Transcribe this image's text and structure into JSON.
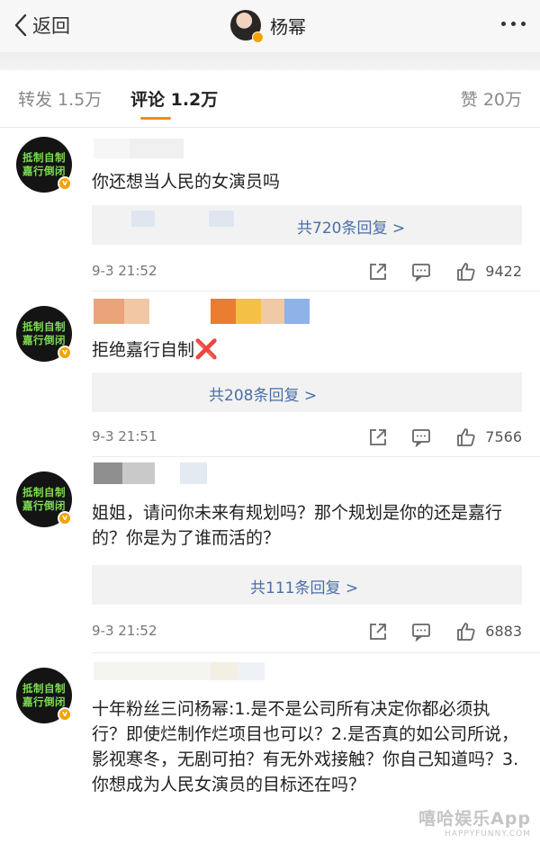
{
  "header": {
    "back_label": "返回",
    "title": "杨幂"
  },
  "tabs": {
    "repost": "转发 1.5万",
    "comments": "评论 1.2万",
    "likes": "赞 20万"
  },
  "avatar_text": [
    "抵制自制",
    "嘉行倒闭"
  ],
  "comments": [
    {
      "text": "你还想当人民的女演员吗",
      "replies": "共720条回复 >",
      "time": "9-3 21:52",
      "likes": "9422"
    },
    {
      "text": "拒绝嘉行自制",
      "emoji": "❌",
      "replies": "共208条回复 >",
      "time": "9-3 21:51",
      "likes": "7566"
    },
    {
      "text": "姐姐，请问你未来有规划吗？那个规划是你的还是嘉行的？你是为了谁而活的？",
      "replies": "共111条回复 >",
      "time": "9-3 21:52",
      "likes": "6883"
    },
    {
      "text": "十年粉丝三问杨幂:1.是不是公司所有决定你都必须执行？即使烂制作烂项目也可以？2.是否真的如公司所说，影视寒冬，无剧可拍？有无外戏接触？你自己知道吗？3.你想成为人民女演员的目标还在吗？"
    }
  ],
  "watermark": {
    "main": "嘻哈娱乐App",
    "sub": "HAPPYFUNNY.COM"
  },
  "colors": {
    "accent": "#f28c1a",
    "link": "#4a6ea8",
    "badge": "#f5a100",
    "avatar_text": "#7dde52"
  }
}
